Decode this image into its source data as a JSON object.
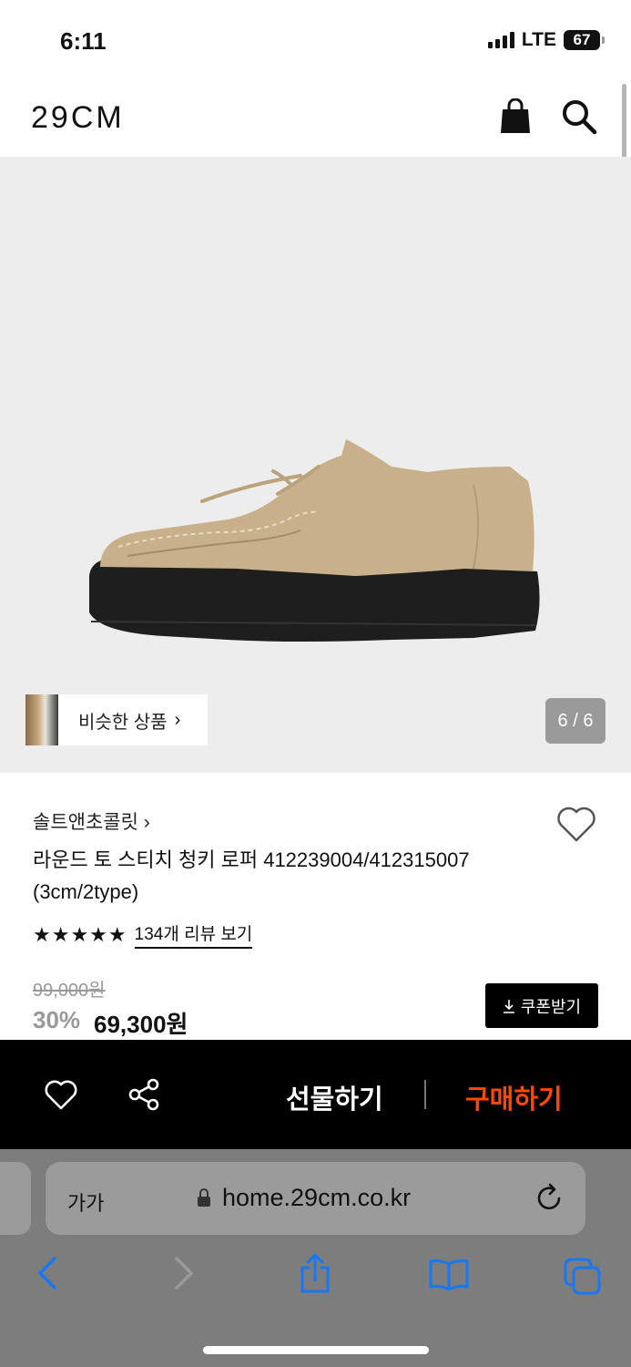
{
  "status": {
    "time": "6:11",
    "network": "LTE",
    "battery": "67"
  },
  "header": {
    "logo": "29CM",
    "bag_icon": "shopping-bag-icon",
    "search_icon": "search-icon"
  },
  "gallery": {
    "similar_label": "비슷한 상품",
    "counter": "6 / 6"
  },
  "product": {
    "brand": "솔트앤초콜릿",
    "title": "라운드 토 스티치 청키 로퍼 412239004/412315007 (3cm/2type)",
    "rating_stars": "★★★★★",
    "review_link": "134개 리뷰 보기",
    "original_price": "99,000원",
    "discount": "30%",
    "price": "69,300원",
    "coupon_label": "쿠폰받기"
  },
  "actionbar": {
    "gift_label": "선물하기",
    "buy_label": "구매하기",
    "buy_color": "#ff4800"
  },
  "browser": {
    "text_size": "가가",
    "url": "home.29cm.co.kr"
  }
}
